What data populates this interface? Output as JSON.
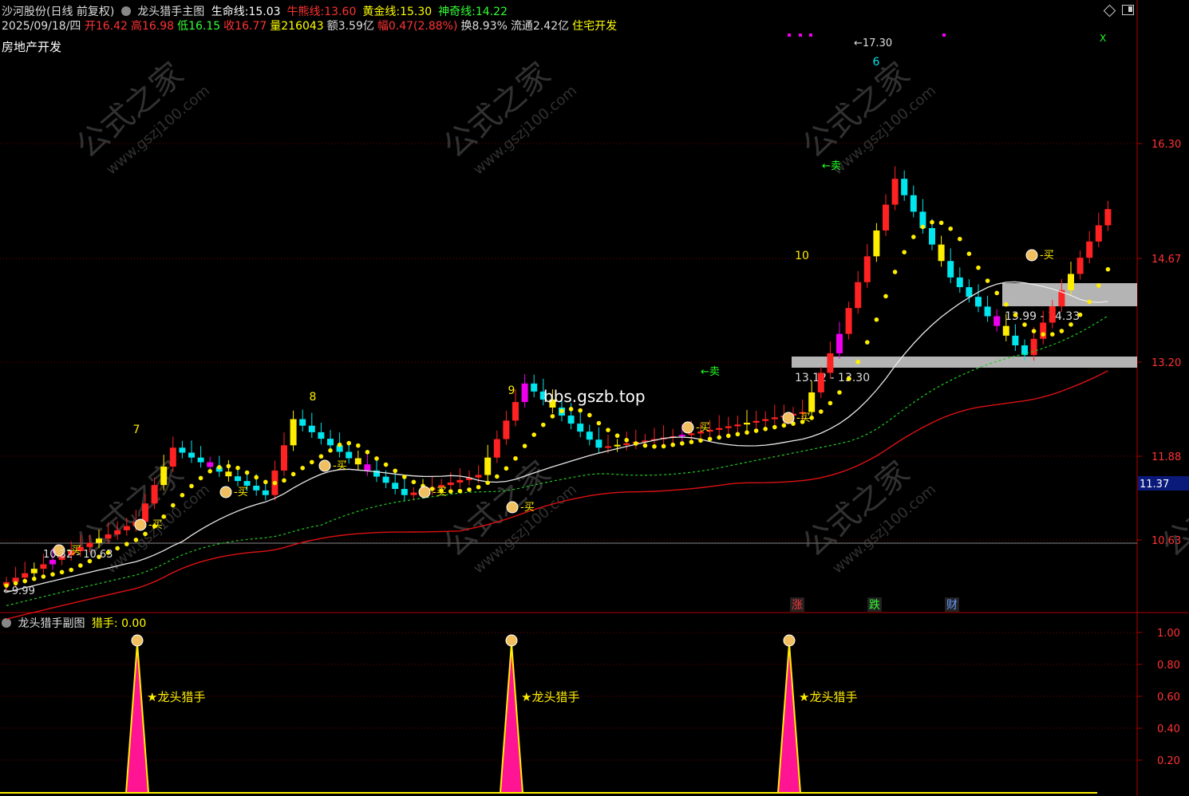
{
  "header": {
    "stock_name": "沙河股份(日线 前复权)",
    "indicator_main": "龙头猎手主图",
    "lines": [
      {
        "label": "生命线:",
        "value": "15.03",
        "color": "#ffffff"
      },
      {
        "label": "牛熊线:",
        "value": "13.60",
        "color": "#ff3333"
      },
      {
        "label": "黄金线:",
        "value": "15.30",
        "color": "#ffff00"
      },
      {
        "label": "神奇线:",
        "value": "14.22",
        "color": "#33ff33"
      }
    ],
    "date": "2025/09/18/四",
    "quote": [
      {
        "label": "开",
        "value": "16.42",
        "color": "#ff3333"
      },
      {
        "label": "高",
        "value": "16.98",
        "color": "#ff3333"
      },
      {
        "label": "低",
        "value": "16.15",
        "color": "#33ff33"
      },
      {
        "label": "收",
        "value": "16.77",
        "color": "#ff3333"
      },
      {
        "label": "量",
        "value": "216043",
        "color": "#ffff00"
      },
      {
        "label": "额",
        "value": "3.59亿",
        "color": "#dddddd"
      },
      {
        "label": "幅",
        "value": "0.47(2.88%)",
        "color": "#ff3333"
      },
      {
        "label": "换",
        "value": "8.93%",
        "color": "#dddddd"
      },
      {
        "label": "流通",
        "value": "2.42亿",
        "color": "#dddddd"
      },
      {
        "label": "",
        "value": "住宅开发",
        "color": "#ffff00"
      }
    ],
    "sector": "房地产开发",
    "top_right_icons": [
      "diamond-icon",
      "window-icon"
    ]
  },
  "sub": {
    "title": "龙头猎手副图",
    "label": "猎手:",
    "value": "0.00",
    "signal_text": "★龙头猎手"
  },
  "watermark": {
    "main": "公式之家",
    "url": "www.gszj100.com",
    "center": "bbs.gszb.top"
  },
  "price_axis": {
    "ticks": [
      "16.30",
      "14.67",
      "13.20",
      "11.88",
      "10.63"
    ],
    "current_price": "11.37"
  },
  "sub_axis": {
    "ticks": [
      "1.00",
      "0.80",
      "0.60",
      "0.40",
      "0.20"
    ]
  },
  "chart_data": {
    "type": "candlestick",
    "zones": [
      {
        "label": "13.12 - 13.30"
      },
      {
        "label": "13.99 - 14.33"
      }
    ],
    "markers": {
      "counts": [
        "7",
        "8",
        "9",
        "10",
        "6"
      ],
      "buy": "买",
      "sell": "卖",
      "extremes": [
        "←9.99",
        "10.32 - 10.63",
        "←17.30"
      ]
    },
    "bottom_tags": [
      {
        "text": "涨",
        "color": "#ff3333"
      },
      {
        "text": "跌",
        "color": "#33ff33"
      },
      {
        "text": "财",
        "color": "#6699ff"
      }
    ]
  }
}
